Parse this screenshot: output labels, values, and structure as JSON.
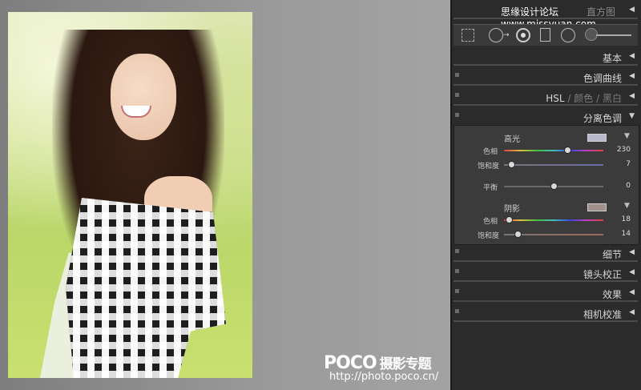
{
  "watermark": {
    "logo": "POCO",
    "logo_sub": "摄影专题",
    "url": "http://photo.poco.cn/"
  },
  "header": {
    "site_text": "思缘设计论坛  www.missyuan.com",
    "section_label": "直方图"
  },
  "tools": {
    "icons": [
      "crop-grid-icon",
      "spot-removal-icon",
      "red-eye-icon",
      "graduated-filter-icon",
      "radial-filter-icon",
      "adjustment-brush-icon"
    ]
  },
  "panels": {
    "basic": "基本",
    "tone_curve": "色调曲线",
    "hsl": {
      "a": "HSL",
      "sep1": "/",
      "b": "颜色",
      "sep2": "/",
      "c": "黑白"
    },
    "split_toning": "分离色调",
    "detail": "细节",
    "lens": "镜头校正",
    "effects": "效果",
    "camera": "相机校准"
  },
  "split_toning": {
    "highlights": {
      "title": "高光",
      "chip_color": "#b9b9cc",
      "hue_label": "色相",
      "hue_value": "230",
      "hue_fraction": 0.64,
      "sat_label": "饱和度",
      "sat_value": "7",
      "sat_fraction": 0.07
    },
    "balance": {
      "label": "平衡",
      "value": "0",
      "fraction": 0.5
    },
    "shadows": {
      "title": "阴影",
      "chip_color": "#a0918a",
      "hue_label": "色相",
      "hue_value": "18",
      "hue_fraction": 0.05,
      "sat_label": "饱和度",
      "sat_value": "14",
      "sat_fraction": 0.14
    }
  }
}
